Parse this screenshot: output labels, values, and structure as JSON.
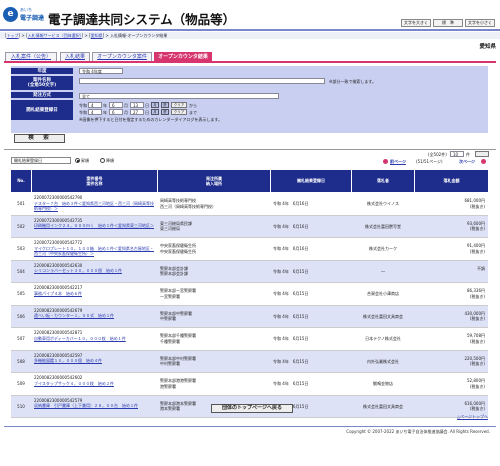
{
  "header": {
    "logo_line1": "あいち",
    "logo_line2": "電子調達",
    "app_title": "電子調達共同システム（物品等）",
    "font_buttons": [
      "文字を大きく",
      "標　準",
      "文字を小さく"
    ]
  },
  "breadcrumb": {
    "items": [
      "トップ",
      "入札情報サービス（団体選択）",
      "愛知県",
      "入札情報-オープンカウンタ結果"
    ],
    "separator": " > "
  },
  "prefecture": "愛知県",
  "tabs": [
    "入札案件（公告）",
    "入札結果",
    "オープンカウンタ案件",
    "オープンカウンタ結果"
  ],
  "form": {
    "nendo_label": "年度",
    "nendo_value": "令和 4年度",
    "case_label": "案件名称",
    "case_sub": "(全角50文字)",
    "case_note": "※部分一致で検索します。",
    "method_label": "発注方式",
    "method_value": "全て",
    "date_label": "開札結果登録日",
    "era": "令和",
    "from": {
      "y": "4",
      "m": "6",
      "d": "13",
      "dow": "月"
    },
    "to": {
      "y": "4",
      "m": "6",
      "d": "27",
      "dow": "月"
    },
    "unit_y": "年",
    "unit_m": "月",
    "unit_d": "日",
    "calendar_label": "暦",
    "clear_label": "クリア",
    "from_suffix": "から",
    "to_suffix": "まで",
    "calendar_note": "※画像を押下すると日付を指定するためのカレンダーダイアログを表示します。",
    "search_button": "検　索"
  },
  "results": {
    "sort_value": "開札結果登録日",
    "order_asc": "昇順",
    "order_desc": "降順",
    "total": "(全502件)",
    "per_page": "10",
    "per_page_suffix": "件",
    "prev": "前ページ",
    "page_indicator": "(51/51ページ)",
    "next": "次ページ",
    "columns": [
      "No.",
      "案件番号\n案件名称",
      "発注所属\n納入場所",
      "開札結果登録日",
      "落札者",
      "落札金額"
    ],
    "rows": [
      {
        "no": "501",
        "id": "220007230000054279​0",
        "name": "テスター７台　始め３件＜愛知県西三河地区・西三河（岡崎高等技術専門校）＞",
        "dept": "岡崎高等技術専門校",
        "place": "西三河（岡崎高等技術専門校）",
        "date": "令和 4年　6月16日",
        "winner": "株式会社ウイノス",
        "amount": "681,000円",
        "tax": "(税抜き)"
      },
      {
        "no": "502",
        "id": "220007230000054273​5",
        "name": "印刷機用インク２４，０００ｍｌ　始め１件＜愛知県東三河地区＞",
        "dept": "東三河総局県民課",
        "place": "東三河総局",
        "date": "令和 4年　6月16日",
        "winner": "株式会社富田謄写堂",
        "amount": "93,600円",
        "tax": "(税抜き)"
      },
      {
        "no": "503",
        "id": "220007230000054277​2",
        "name": "マイクロプレート１０，１００箱　始め１件＜愛知県名古屋地区・西三河（中央家畜保健衛生所）＞",
        "dept": "中央家畜保健衛生所",
        "place": "中央家畜保健衛生所",
        "date": "令和 4年　6月16日",
        "winner": "株式会社カーク",
        "amount": "91,400円",
        "tax": "(税抜き)"
      },
      {
        "no": "504",
        "id": "220008230000054263​0",
        "name": "シリコンラバーセット３０，０００個　始め１件",
        "dept": "警察本部会計課",
        "place": "警察本部会計課",
        "date": "令和 4年　6月15日",
        "winner": "―",
        "amount": "不調",
        "tax": ""
      },
      {
        "no": "505",
        "id": "220008230000054221​7",
        "name": "事務パイプ４本　始め６件",
        "dept": "警察本部一宮警察署",
        "place": "一宮警察署",
        "date": "令和 4年　6月15日",
        "winner": "合資会社小澤商店",
        "amount": "86,336円",
        "tax": "(税抜き)"
      },
      {
        "no": "506",
        "id": "220008230000054267​9",
        "name": "遺べい板・カウンター１，００式　始め１件",
        "dept": "警察本部中警察署",
        "place": "中警察署",
        "date": "令和 4年　6月15日",
        "winner": "株式会社富田文具商会",
        "amount": "430,000円",
        "tax": "(税抜き)"
      },
      {
        "no": "507",
        "id": "220008230000054287​1",
        "name": "自動車用ボディーカバー１０，０００枚　始め１件",
        "dept": "警察本部千種警察署",
        "place": "千種警察署",
        "date": "令和 4年　6月15日",
        "winner": "日本テクノ株式会社",
        "amount": "59,708円",
        "tax": "(税抜き)"
      },
      {
        "no": "508",
        "id": "220008230000054259​7",
        "name": "多機能図鑑１０，０００個　始め４件",
        "dept": "警察本部中村警察署",
        "place": "中村警察署",
        "date": "令和 4年　6月15日",
        "winner": "内外弘業株式会社",
        "amount": "220,500円",
        "tax": "(税抜き)"
      },
      {
        "no": "509",
        "id": "220008230000054260​2",
        "name": "ブイスタップサック４，０００枚　始め２件",
        "dept": "警察本部港港警察署",
        "place": "港警察署",
        "date": "令和 4年　6月15日",
        "winner": "鯱鳴金物店",
        "amount": "52,800円",
        "tax": "(税抜き)"
      },
      {
        "no": "510",
        "id": "220008230000054257​9",
        "name": "収納書庫　引戸書庫（上下兼用）２８，００台　始め１件",
        "dept": "警察本部港本警察署",
        "place": "港本警察署",
        "date": "令和 4年　6月15日",
        "winner": "株式会社富田文具商会",
        "amount": "616,000円",
        "tax": "(税抜き)"
      }
    ]
  },
  "bottom_button": "団体のトップページへ戻る",
  "page_top": "△ページトップへ",
  "copyright": "Copyright © 2007-2022 あいち電子自治体推進協議会. All Rights Reserved.",
  "colors": {
    "accent_nav": "#1e2d8c",
    "tab_active": "#d6356e",
    "form_bg": "#c9cff0",
    "row_alt": "#dde2f6"
  }
}
